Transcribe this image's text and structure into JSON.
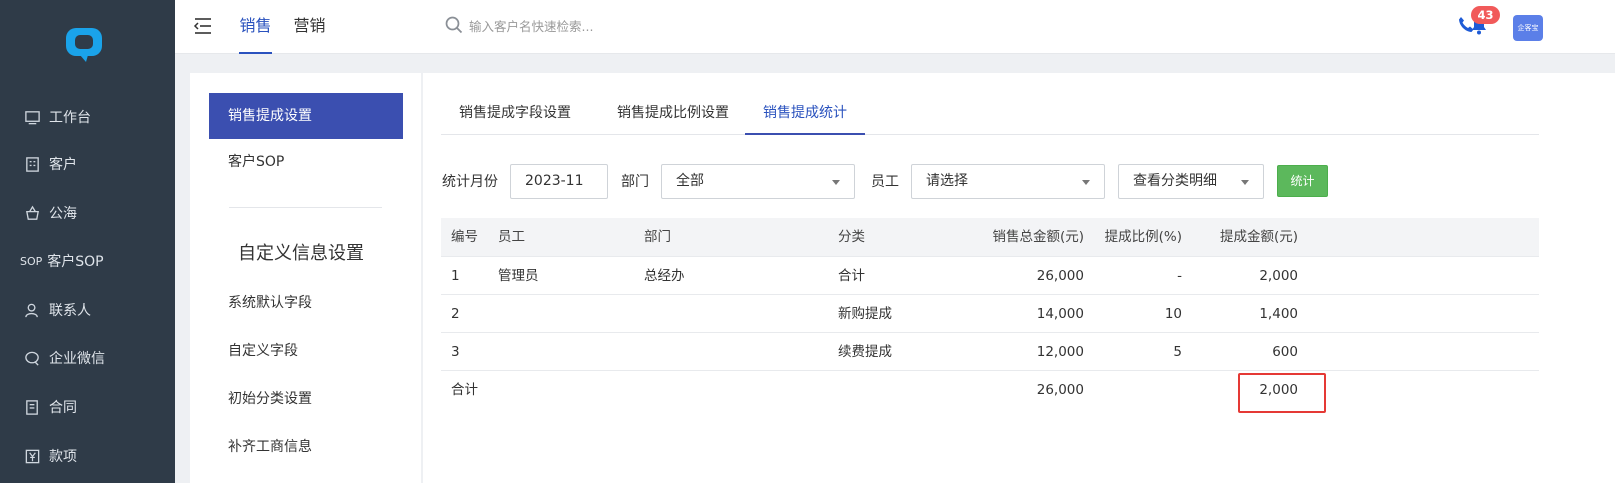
{
  "app": {
    "brand_color": "#2a52be",
    "nav_bg": "#2f3b48"
  },
  "nav": {
    "items": [
      {
        "label": "工作台",
        "icon": "monitor-icon"
      },
      {
        "label": "客户",
        "icon": "building-icon"
      },
      {
        "label": "公海",
        "icon": "basket-icon"
      },
      {
        "label": "客户SOP",
        "icon": "sop-icon",
        "icon_text": "SOP"
      },
      {
        "label": "联系人",
        "icon": "user-icon"
      },
      {
        "label": "企业微信",
        "icon": "chat-icon"
      },
      {
        "label": "合同",
        "icon": "contract-icon"
      },
      {
        "label": "款项",
        "icon": "yuan-icon"
      }
    ]
  },
  "header": {
    "tabs": [
      {
        "label": "销售",
        "active": true
      },
      {
        "label": "营销",
        "active": false
      }
    ],
    "search": {
      "placeholder": "输入客户名快速检索..."
    },
    "notification_count": "43",
    "avatar_text": "企客宝"
  },
  "settings": {
    "items": [
      {
        "label": "销售提成设置",
        "active": true
      },
      {
        "label": "客户SOP",
        "active": false
      }
    ],
    "section_title": "自定义信息设置",
    "section_items": [
      "系统默认字段",
      "自定义字段",
      "初始分类设置",
      "补齐工商信息"
    ]
  },
  "main": {
    "tabs": [
      {
        "label": "销售提成字段设置",
        "active": false
      },
      {
        "label": "销售提成比例设置",
        "active": false
      },
      {
        "label": "销售提成统计",
        "active": true
      }
    ],
    "filters": {
      "month_label": "统计月份",
      "month_value": "2023-11",
      "dept_label": "部门",
      "dept_value": "全部",
      "staff_label": "员工",
      "staff_placeholder": "请选择",
      "detail_value": "查看分类明细",
      "submit_label": "统计"
    },
    "table": {
      "columns": [
        "编号",
        "员工",
        "部门",
        "分类",
        "销售总金额(元)",
        "提成比例(%)",
        "提成金额(元)"
      ],
      "rows": [
        {
          "no": "1",
          "staff": "管理员",
          "dept": "总经办",
          "category": "合计",
          "total": "26,000",
          "rate": "-",
          "commission": "2,000"
        },
        {
          "no": "2",
          "staff": "",
          "dept": "",
          "category": "新购提成",
          "total": "14,000",
          "rate": "10",
          "commission": "1,400"
        },
        {
          "no": "3",
          "staff": "",
          "dept": "",
          "category": "续费提成",
          "total": "12,000",
          "rate": "5",
          "commission": "600"
        }
      ],
      "summary": {
        "label": "合计",
        "total": "26,000",
        "commission": "2,000"
      },
      "highlight_color": "#e53935"
    }
  }
}
